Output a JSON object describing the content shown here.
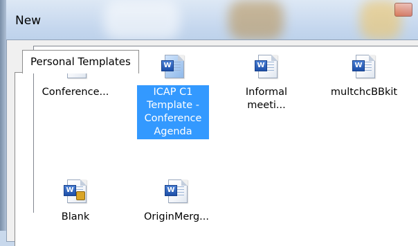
{
  "window": {
    "title": "New"
  },
  "tabs": [
    {
      "label": "Personal Templates",
      "active": true
    }
  ],
  "templates": [
    {
      "label": "Conference...",
      "icon": "word-document-icon",
      "selected": false
    },
    {
      "label": "ICAP C1 Template - Conference Agenda",
      "icon": "word-document-icon",
      "selected": true
    },
    {
      "label": "Informal meeti...",
      "icon": "word-document-icon",
      "selected": false
    },
    {
      "label": "multchcBBkit",
      "icon": "word-document-icon",
      "selected": false
    },
    {
      "label": "Blank",
      "icon": "word-blank-document-icon",
      "selected": false
    },
    {
      "label": "OriginMerg...",
      "icon": "word-document-icon",
      "selected": false
    }
  ],
  "colors": {
    "selection": "#3399ff",
    "window_chrome": "#c9d9ec"
  }
}
